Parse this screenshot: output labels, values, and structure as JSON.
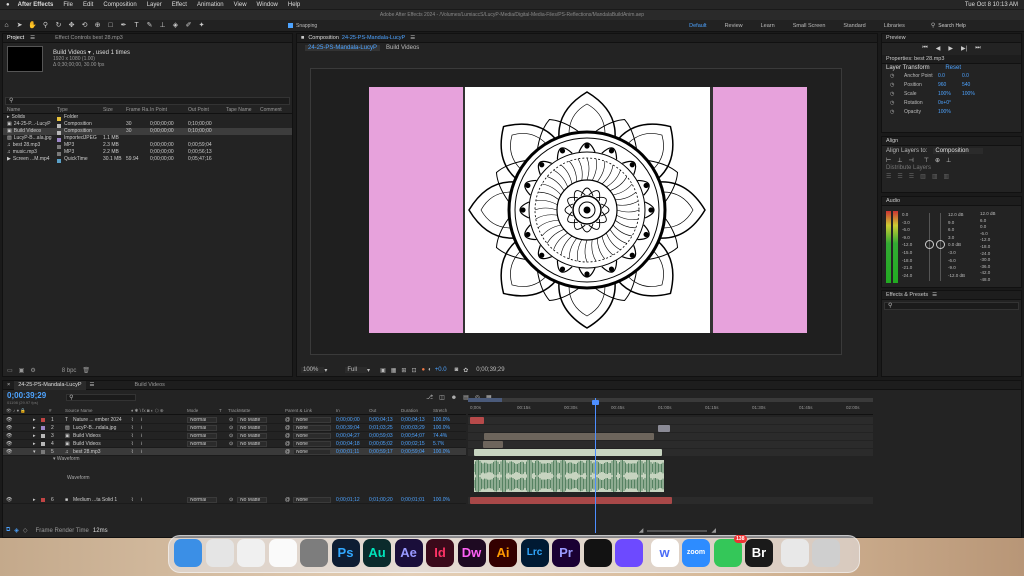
{
  "menubar": {
    "app": "After Effects",
    "items": [
      "File",
      "Edit",
      "Composition",
      "Layer",
      "Effect",
      "Animation",
      "View",
      "Window",
      "Help"
    ],
    "clock": "Tue Oct 8  10:13 AM"
  },
  "window_title": "Adobe After Effects 2024 - /Volumes/LumiaccS/LucyP-Media/Digital-Media-Files/PS-Reflections/MandalaBuildAnim.aep",
  "toolbar": {
    "snapping": "Snapping",
    "workspaces": [
      "Default",
      "Review",
      "Learn",
      "Small Screen",
      "Standard",
      "Libraries"
    ],
    "search_placeholder": "Search Help"
  },
  "project": {
    "tab": "Project",
    "effect_controls": "Effect Controls best 28.mp3",
    "selected_name": "Build Videos ▾ , used 1 times",
    "selected_info1": "1920 x 1080 (1.00)",
    "selected_info2": "Δ 0;30;00;00, 30.00 fps",
    "search_placeholder": "",
    "columns": [
      "Name",
      "Type",
      "Size",
      "Frame Ra...",
      "In Point",
      "Out Point",
      "Tape Name",
      "Comment"
    ],
    "items": [
      {
        "name": "Solids",
        "type": "Folder",
        "size": "",
        "fps": "",
        "in": "",
        "out": "",
        "color": "#e8c23b",
        "icon": "folder"
      },
      {
        "name": "24-25-P...-LucyP",
        "type": "Composition",
        "size": "",
        "fps": "30",
        "in": "0;00;00;00",
        "out": "0;10;00;00",
        "color": "#b8b8b8",
        "icon": "comp"
      },
      {
        "name": "Build Videos",
        "type": "Composition",
        "size": "",
        "fps": "30",
        "in": "0;00;00;00",
        "out": "0;10;00;00",
        "color": "#b8b8b8",
        "icon": "comp",
        "selected": true
      },
      {
        "name": "LucyP-B...ala.jpg",
        "type": "ImportedJPEG",
        "size": "1.1 MB",
        "fps": "",
        "in": "",
        "out": "",
        "color": "#9c86c8",
        "icon": "img"
      },
      {
        "name": "best 28.mp3",
        "type": "MP3",
        "size": "2.3 MB",
        "fps": "",
        "in": "0;00;00;00",
        "out": "0;00;59;04",
        "color": "#7a7a7a",
        "icon": "audio"
      },
      {
        "name": "music.mp3",
        "type": "MP3",
        "size": "2.2 MB",
        "fps": "",
        "in": "0;00;00;00",
        "out": "0;00;56;13",
        "color": "#7a7a7a",
        "icon": "audio"
      },
      {
        "name": "Screen ...M.mp4",
        "type": "QuickTime",
        "size": "30.1 MB",
        "fps": "59.94",
        "in": "0;00;00;00",
        "out": "0;05;47;16",
        "color": "#5aa0c8",
        "icon": "video"
      }
    ],
    "bpc": "8 bpc"
  },
  "composition": {
    "tab_label": "Composition",
    "comp_name": "24-25-PS-Mandala-LucyP",
    "breadcrumb1": "24-25-PS-Mandala-LucyP",
    "breadcrumb2": "Build Videos",
    "zoom": "100%",
    "resolution": "Full",
    "exposure": "+0.0",
    "timecode": "0;00;39;29",
    "pink": "#e7a2dc"
  },
  "right_panels": {
    "preview_title": "Preview",
    "properties_title": "Properties: best 28.mp3",
    "layer_transform": "Layer Transform",
    "reset": "Reset",
    "props": [
      {
        "name": "Anchor Point",
        "v1": "0.0",
        "v2": "0.0"
      },
      {
        "name": "Position",
        "v1": "960",
        "v2": "540"
      },
      {
        "name": "Scale",
        "v1": "100%",
        "v2": "100%"
      },
      {
        "name": "Rotation",
        "v1": "0x+0°",
        "v2": ""
      },
      {
        "name": "Opacity",
        "v1": "100%",
        "v2": ""
      }
    ],
    "align_title": "Align",
    "align_to_label": "Align Layers to:",
    "align_to_value": "Composition",
    "distribute": "Distribute Layers",
    "audio_title": "Audio",
    "audio_left_scale": [
      "0.0",
      "-3.0",
      "-6.0",
      "-9.0",
      "-12.0",
      "-15.0",
      "-18.0",
      "-21.0",
      "-24.0"
    ],
    "audio_right_db": [
      "12.0 dB",
      "6.0",
      "0.0",
      "-6.0",
      "-12.0",
      "-18.0",
      "-24.0",
      "-30.0",
      "-36.0",
      "-42.0",
      "-48.0"
    ],
    "audio_right_scale": [
      "12.0 dB",
      "9.0",
      "6.0",
      "3.0",
      "0.0 dB",
      "-3.0",
      "-6.0",
      "-9.0",
      "-12.0 dB"
    ],
    "effects_title": "Effects & Presets",
    "effects_search": ""
  },
  "timeline": {
    "tab1": "24-25-PS-Mandala-LucyP",
    "tab2": "Build Videos",
    "current_time": "0;00:39;29",
    "frame_info": "01198 (29.97 fps)",
    "columns": [
      "#",
      "Source Name",
      "Mode",
      "T",
      "TrackMatte",
      "Parent & Link",
      "In",
      "Out",
      "Duration",
      "Stretch"
    ],
    "ruler": [
      "0;00s",
      "00:15s",
      "00:30s",
      "00:45s",
      "01:00s",
      "01:15s",
      "01:30s",
      "01:45s",
      "02:00s"
    ],
    "layers": [
      {
        "num": "1",
        "icon": "T",
        "name": "Nature ... ember 2024",
        "mode": "Normal",
        "matte": "No Matte",
        "parent": "None",
        "in": "0;00;00;00",
        "out": "0;00;04;13",
        "dur": "0;00;04;13",
        "stretch": "100.0%",
        "color": "#c14444"
      },
      {
        "num": "2",
        "icon": "img",
        "name": "LucyP-B...ndala.jpg",
        "mode": "Normal",
        "matte": "No Matte",
        "parent": "None",
        "in": "0;00;39;04",
        "out": "0;01;03;25",
        "dur": "0;00;03;29",
        "stretch": "100.0%",
        "color": "#9c86c8"
      },
      {
        "num": "3",
        "icon": "comp",
        "name": "Build Videos",
        "mode": "Normal",
        "matte": "No Matte",
        "parent": "None",
        "in": "0;00;04;27",
        "out": "0;00;59;03",
        "dur": "0;00;54;07",
        "stretch": "74.4%",
        "color": "#b8b8b8"
      },
      {
        "num": "4",
        "icon": "comp",
        "name": "Build Videos",
        "mode": "Normal",
        "matte": "No Matte",
        "parent": "None",
        "in": "0;00;04;18",
        "out": "0;00;05;02",
        "dur": "0;00;02;15",
        "stretch": "5.7%",
        "color": "#b8b8b8"
      },
      {
        "num": "5",
        "icon": "audio",
        "name": "best 28.mp3",
        "mode": "",
        "matte": "",
        "parent": "None",
        "in": "0;00;01;11",
        "out": "0;00;59;17",
        "dur": "0;00;59;04",
        "stretch": "100.0%",
        "color": "#7a7a7a",
        "selected": true
      },
      {
        "num": "6",
        "icon": "solid",
        "name": "Medium ...ta Solid 1",
        "mode": "Normal",
        "matte": "No Matte",
        "parent": "None",
        "in": "0;00;01;12",
        "out": "0;01;00;20",
        "dur": "0;00;01;01",
        "stretch": "100.0%",
        "color": "#c14444"
      }
    ],
    "waveform_label": "Waveform",
    "waveform_sub": "Waveform",
    "frame_render_label": "Frame Render Time",
    "frame_render_value": "12ms"
  },
  "dock": {
    "apps": [
      {
        "name": "Finder",
        "label": "",
        "bg": "#3b8fe6"
      },
      {
        "name": "Launchpad",
        "label": "",
        "bg": "#e5e5e5"
      },
      {
        "name": "Chrome",
        "label": "",
        "bg": "#f0f0f0"
      },
      {
        "name": "Freeform",
        "label": "",
        "bg": "#fafafa"
      },
      {
        "name": "System Settings",
        "label": "",
        "bg": "#7d7d7d"
      },
      {
        "name": "Photoshop",
        "label": "Ps",
        "bg": "#0e1d33",
        "fg": "#31a8ff"
      },
      {
        "name": "Audition",
        "label": "Au",
        "bg": "#0b2b2c",
        "fg": "#00e4bb"
      },
      {
        "name": "After Effects",
        "label": "Ae",
        "bg": "#1a0e3a",
        "fg": "#9999ff"
      },
      {
        "name": "InDesign",
        "label": "Id",
        "bg": "#3a0a1a",
        "fg": "#ff3366"
      },
      {
        "name": "Dreamweaver",
        "label": "Dw",
        "bg": "#1e0a22",
        "fg": "#ff61f6"
      },
      {
        "name": "Illustrator",
        "label": "Ai",
        "bg": "#330000",
        "fg": "#ff9a00"
      },
      {
        "name": "Lightroom Classic",
        "label": "Lrc",
        "bg": "#001a33",
        "fg": "#31a8ff"
      },
      {
        "name": "Premiere Pro",
        "label": "Pr",
        "bg": "#1a0033",
        "fg": "#9999ff"
      },
      {
        "name": "Spotify",
        "label": "",
        "bg": "#121212"
      },
      {
        "name": "Proton VPN",
        "label": "",
        "bg": "#6d4aff"
      },
      {
        "name": "Word",
        "label": "w",
        "bg": "#ffffff",
        "fg": "#4a6cf7"
      },
      {
        "name": "Zoom",
        "label": "zoom",
        "bg": "#2d8cff",
        "fg": "#ffffff"
      },
      {
        "name": "Messages",
        "label": "",
        "bg": "#34c759",
        "badge": "138"
      },
      {
        "name": "Bridge",
        "label": "Br",
        "bg": "#1a1a1a",
        "fg": "#ffffff"
      },
      {
        "name": "Music",
        "label": "",
        "bg": "#e8e8e8"
      },
      {
        "name": "Trash",
        "label": "",
        "bg": "#cfcfcf"
      }
    ]
  }
}
